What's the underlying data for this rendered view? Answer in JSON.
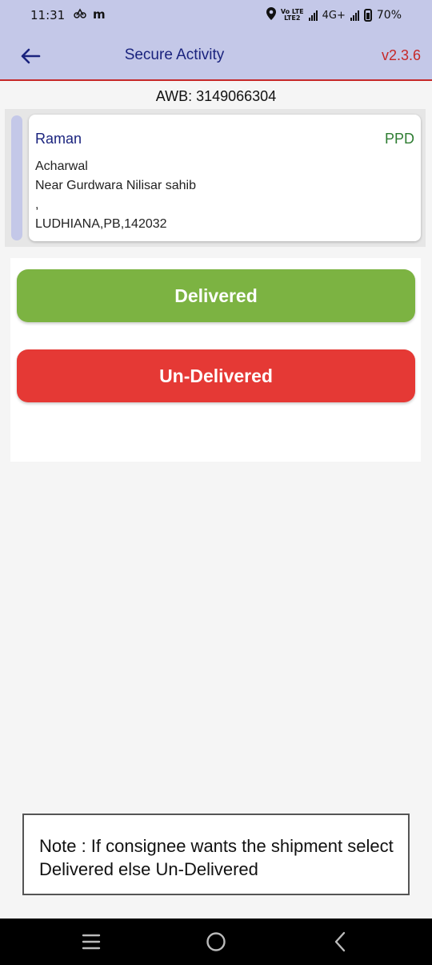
{
  "status_bar": {
    "time": "11:31",
    "notif_icon_1": "ride-icon",
    "notif_icon_2": "m",
    "volte_top": "Vo LTE",
    "volte_bottom": "LTE2",
    "network": "4G+",
    "battery": "70%"
  },
  "app_bar": {
    "title": "Secure Activity",
    "version": "v2.3.6",
    "back_icon": "arrow-left-icon"
  },
  "shipment": {
    "awb": "AWB: 3149066304",
    "consignee": "Raman",
    "payment_type": "PPD",
    "address_line1": "Acharwal",
    "address_line2": "Near Gurdwara Nilisar sahib",
    "address_line3": ",",
    "address_line4": "LUDHIANA,PB,142032"
  },
  "actions": {
    "delivered_label": "Delivered",
    "undelivered_label": "Un-Delivered"
  },
  "note": {
    "text": "Note : If consignee wants the shipment select Delivered else Un-Delivered"
  },
  "colors": {
    "app_bar_bg": "#c4c8e8",
    "title_color": "#1a237e",
    "version_color": "#c62828",
    "ppd_color": "#2e7d32",
    "delivered_bg": "#7cb342",
    "undelivered_bg": "#e53935"
  },
  "nav_bar": {
    "recents_icon": "recents-icon",
    "home_icon": "home-icon",
    "back_icon": "back-icon"
  }
}
